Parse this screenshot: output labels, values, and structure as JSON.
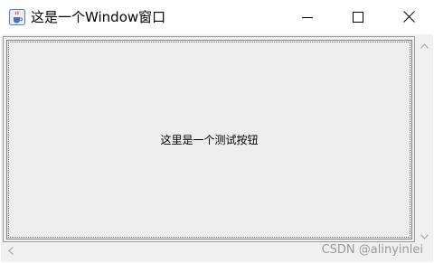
{
  "window": {
    "title": "这是一个Window窗口",
    "icons": {
      "app": "java-cup-icon",
      "minimize": "minimize-icon",
      "maximize": "maximize-icon",
      "close": "close-icon"
    }
  },
  "main": {
    "button_label": "这里是一个测试按钮"
  },
  "scrollbars": {
    "vertical": {
      "up_icon": "chevron-up-icon",
      "down_icon": "chevron-down-icon"
    },
    "horizontal": {
      "left_icon": "chevron-left-icon"
    }
  },
  "watermark": "CSDN @alinyinlei",
  "colors": {
    "client_background": "#f0f0f0",
    "titlebar_background": "#ffffff",
    "watermark_text": "#9a9a9a"
  }
}
